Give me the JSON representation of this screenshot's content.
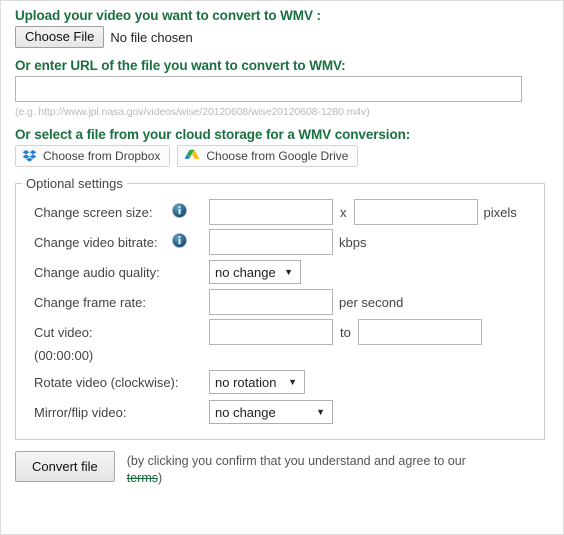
{
  "upload": {
    "heading": "Upload your video you want to convert to WMV :",
    "choose_file_label": "Choose File",
    "no_file_text": "No file chosen"
  },
  "url": {
    "heading": "Or enter URL of the file you want to convert to WMV:",
    "value": "",
    "placeholder": "",
    "hint": "(e.g. http://www.jpl.nasa.gov/videos/wise/20120608/wise20120608-1280.m4v)"
  },
  "cloud": {
    "heading": "Or select a file from your cloud storage for a WMV conversion:",
    "dropbox_label": "Choose from Dropbox",
    "gdrive_label": "Choose from Google Drive",
    "dropbox_icon": "dropbox-icon",
    "gdrive_icon": "google-drive-icon"
  },
  "optional": {
    "legend": "Optional settings",
    "screen_size": {
      "label": "Change screen size:",
      "info_icon": "info-icon",
      "width_value": "",
      "height_value": "",
      "separator": "x",
      "unit": "pixels"
    },
    "bitrate": {
      "label": "Change video bitrate:",
      "info_icon": "info-icon",
      "value": "",
      "unit": "kbps"
    },
    "audio_quality": {
      "label": "Change audio quality:",
      "selected": "no change",
      "options": [
        "no change"
      ]
    },
    "frame_rate": {
      "label": "Change frame rate:",
      "value": "",
      "unit": "per second"
    },
    "cut_video": {
      "label": "Cut video:",
      "start_value": "",
      "end_value": "",
      "separator": "to",
      "note": "(00:00:00)"
    },
    "rotate": {
      "label": "Rotate video (clockwise):",
      "selected": "no rotation",
      "options": [
        "no rotation"
      ]
    },
    "mirror": {
      "label": "Mirror/flip video:",
      "selected": "no change",
      "options": [
        "no change"
      ]
    }
  },
  "submit": {
    "button_label": "Convert file",
    "terms_prefix": "(by clicking you confirm that you understand and agree to our ",
    "terms_link": "terms",
    "terms_suffix": ")"
  },
  "colors": {
    "heading_green": "#1a7040",
    "link_green": "#1a7040",
    "info_blue": "#1b5f89",
    "dropbox_blue": "#1e7ed6"
  }
}
